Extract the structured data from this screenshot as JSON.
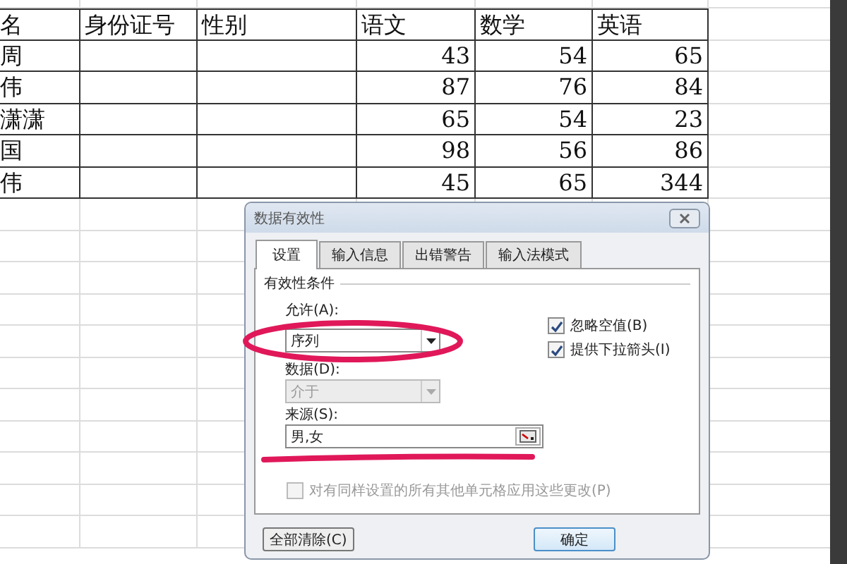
{
  "sheet": {
    "columns": [
      "名",
      "身份证号",
      "性别",
      "语文",
      "数学",
      "英语"
    ],
    "rows": [
      {
        "name": "周",
        "scores": [
          "43",
          "54",
          "65"
        ]
      },
      {
        "name": "伟",
        "scores": [
          "87",
          "76",
          "84"
        ]
      },
      {
        "name": "潇潇",
        "scores": [
          "65",
          "54",
          "23"
        ]
      },
      {
        "name": "国",
        "scores": [
          "98",
          "56",
          "86"
        ]
      },
      {
        "name": "伟",
        "scores": [
          "45",
          "65",
          "344"
        ]
      }
    ]
  },
  "dialog": {
    "title": "数据有效性",
    "tabs": [
      {
        "label": "设置",
        "selected": true
      },
      {
        "label": "输入信息",
        "selected": false
      },
      {
        "label": "出错警告",
        "selected": false
      },
      {
        "label": "输入法模式",
        "selected": false
      }
    ],
    "group": "有效性条件",
    "allow": {
      "label": "允许(A):",
      "value": "序列"
    },
    "data": {
      "label": "数据(D):",
      "value": "介于",
      "disabled": true
    },
    "checks": [
      {
        "label": "忽略空值(B)",
        "checked": true
      },
      {
        "label": "提供下拉箭头(I)",
        "checked": true
      }
    ],
    "source": {
      "label": "来源(S):",
      "value": "男,女"
    },
    "apply_all": {
      "label": "对有同样设置的所有其他单元格应用这些更改(P)",
      "checked": false,
      "disabled": true
    },
    "buttons": [
      {
        "kind": "clear",
        "label": "全部清除(C)"
      },
      {
        "kind": "ok",
        "label": "确定"
      }
    ]
  },
  "annotations": {
    "ellipse": {
      "color": "#e0185a"
    },
    "underline": {
      "color": "#e0185a"
    }
  }
}
